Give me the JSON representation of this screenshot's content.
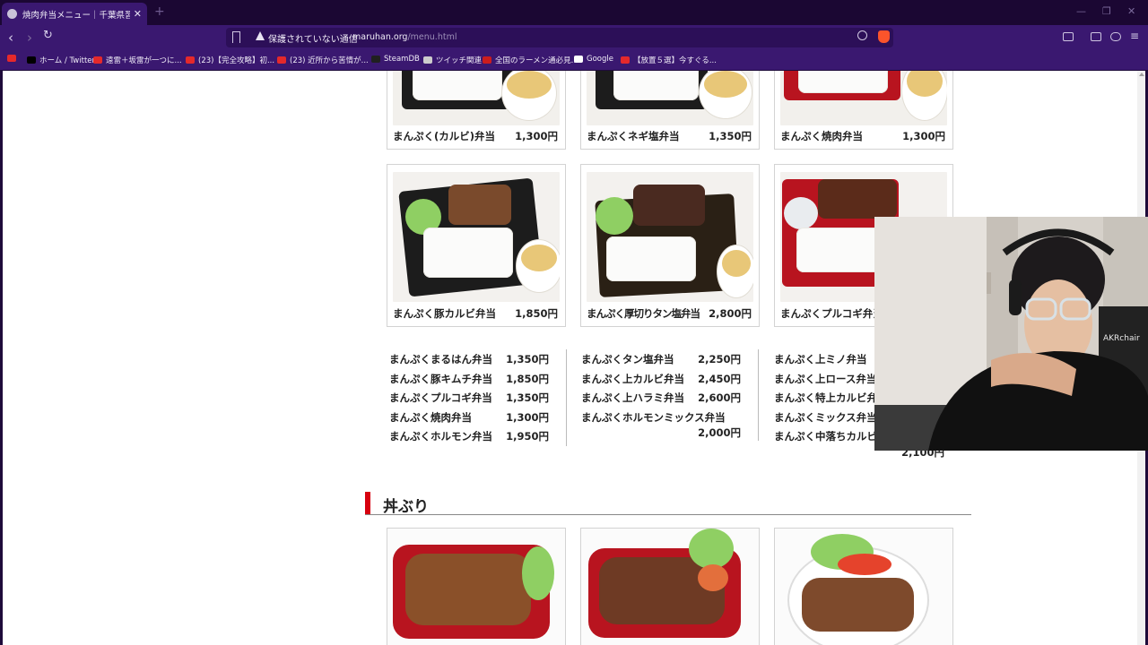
{
  "tab": {
    "title": "焼肉弁当メニュー｜千葉県習志野市",
    "close": "✕",
    "new": "+"
  },
  "toolbar": {
    "security_text": "保護されていない通信",
    "url_host": "maruhan.org",
    "url_path": "/menu.html"
  },
  "bookmarks": [
    {
      "label": "",
      "color": "#e5292b"
    },
    {
      "label": "ホーム / Twitter",
      "color": "#000000"
    },
    {
      "label": "遠雷＋坂雷が一つに...",
      "color": "#e5292b"
    },
    {
      "label": "(23)【完全攻略】初...",
      "color": "#e5292b"
    },
    {
      "label": "(23) 近所から苦情が...",
      "color": "#e5292b"
    },
    {
      "label": "SteamDB",
      "color": "#202020"
    },
    {
      "label": "ツイッチ関連",
      "color": "#cccccc"
    },
    {
      "label": "全国のラーメン通必見...",
      "color": "#cc1d1d"
    },
    {
      "label": "Google",
      "color": "#ffffff"
    },
    {
      "label": "【放置５選】今すぐる...",
      "color": "#e5292b"
    }
  ],
  "cards_top": [
    {
      "name": "まんぷく(カルビ)弁当",
      "price": "1,300円"
    },
    {
      "name": "まんぷくネギ塩弁当",
      "price": "1,350円"
    },
    {
      "name": "まんぷく焼肉弁当",
      "price": "1,300円"
    }
  ],
  "cards_mid": [
    {
      "name": "まんぷく豚カルビ弁当",
      "price": "1,850円"
    },
    {
      "name": "まんぷく厚切りタン塩弁当",
      "price": "2,800円"
    },
    {
      "name": "まんぷくプルコギ弁当",
      "price": ""
    }
  ],
  "list_col1": [
    {
      "name": "まんぷくまるはん弁当",
      "price": "1,350円"
    },
    {
      "name": "まんぷく豚キムチ弁当",
      "price": "1,850円"
    },
    {
      "name": "まんぷくプルコギ弁当",
      "price": "1,350円"
    },
    {
      "name": "まんぷく焼肉弁当",
      "price": "1,300円"
    },
    {
      "name": "まんぷくホルモン弁当",
      "price": "1,950円"
    }
  ],
  "list_col2": [
    {
      "name": "まんぷくタン塩弁当",
      "price": "2,250円"
    },
    {
      "name": "まんぷく上カルビ弁当",
      "price": "2,450円"
    },
    {
      "name": "まんぷく上ハラミ弁当",
      "price": "2,600円"
    },
    {
      "name": "まんぷくホルモンミックス弁当",
      "price": ""
    },
    {
      "name": "",
      "price": "2,000円"
    }
  ],
  "list_col3": [
    {
      "name": "まんぷく上ミノ弁当",
      "price": ""
    },
    {
      "name": "まんぷく上ロース弁当",
      "price": ""
    },
    {
      "name": "まんぷく特上カルビ弁当",
      "price": ""
    },
    {
      "name": "まんぷくミックス弁当",
      "price": ""
    },
    {
      "name": "まんぷく中落ちカルビ弁当",
      "price": ""
    },
    {
      "name": "",
      "price": "2,100円"
    }
  ],
  "section": {
    "title": "丼ぶり"
  },
  "webcam": {
    "shirt_text": "AKRchair"
  }
}
